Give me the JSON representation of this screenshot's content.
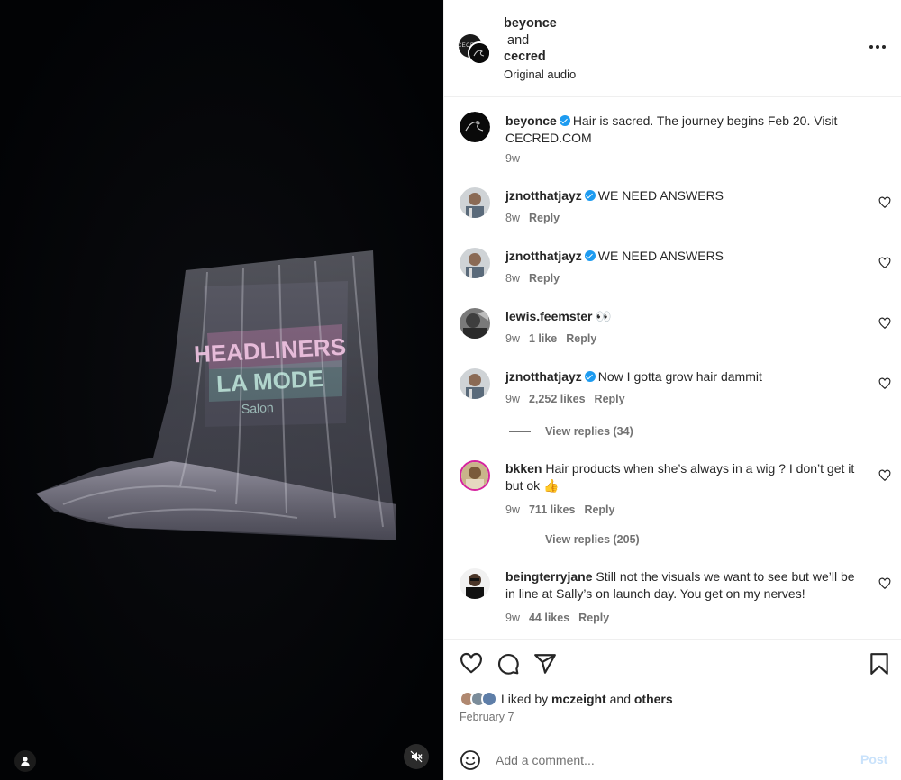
{
  "header": {
    "user1": "beyonce",
    "and_text": "and",
    "user2": "cecred",
    "audio": "Original audio",
    "avatar1_text": "CECRED"
  },
  "media": {
    "neon_line1": "HEADLINERS",
    "neon_line2": "LA MODE",
    "neon_line3": "Salon"
  },
  "caption": {
    "user": "beyonce",
    "text": "Hair is sacred. The journey begins Feb 20. Visit CECRED.COM",
    "time": "9w"
  },
  "comments": [
    {
      "user": "jznotthatjayz",
      "verified": true,
      "text": "WE NEED ANSWERS",
      "time": "8w",
      "likes": "",
      "reply": "Reply"
    },
    {
      "user": "jznotthatjayz",
      "verified": true,
      "text": "WE NEED ANSWERS",
      "time": "8w",
      "likes": "",
      "reply": "Reply"
    },
    {
      "user": "lewis.feemster",
      "verified": false,
      "text": "👀",
      "time": "9w",
      "likes": "1 like",
      "reply": "Reply"
    },
    {
      "user": "jznotthatjayz",
      "verified": true,
      "text": "Now I gotta grow hair dammit",
      "time": "9w",
      "likes": "2,252 likes",
      "reply": "Reply",
      "view_replies": "View replies (34)"
    },
    {
      "user": "bkken",
      "verified": false,
      "text": "Hair products when she’s always in a wig ? I don’t get it but ok 👍",
      "time": "9w",
      "likes": "711 likes",
      "reply": "Reply",
      "view_replies": "View replies (205)"
    },
    {
      "user": "beingterryjane",
      "verified": false,
      "text": "Still not the visuals we want to see but we’ll be in line at Sally’s on launch day. You get on my nerves!",
      "time": "9w",
      "likes": "44 likes",
      "reply": "Reply"
    }
  ],
  "likes": {
    "prefix": "Liked by",
    "user": "mczeight",
    "connector": "and",
    "others": "others"
  },
  "date": "February 7",
  "add_comment": {
    "placeholder": "Add a comment...",
    "post_label": "Post"
  },
  "colors": {
    "verified": "#1d9bf0",
    "muted": "#737373",
    "post_disabled": "#c9e2fb"
  },
  "icons": [
    "heart-icon",
    "comment-icon",
    "share-icon",
    "bookmark-icon",
    "more-icon",
    "emoji-icon",
    "mute-icon",
    "user-tag-icon"
  ]
}
